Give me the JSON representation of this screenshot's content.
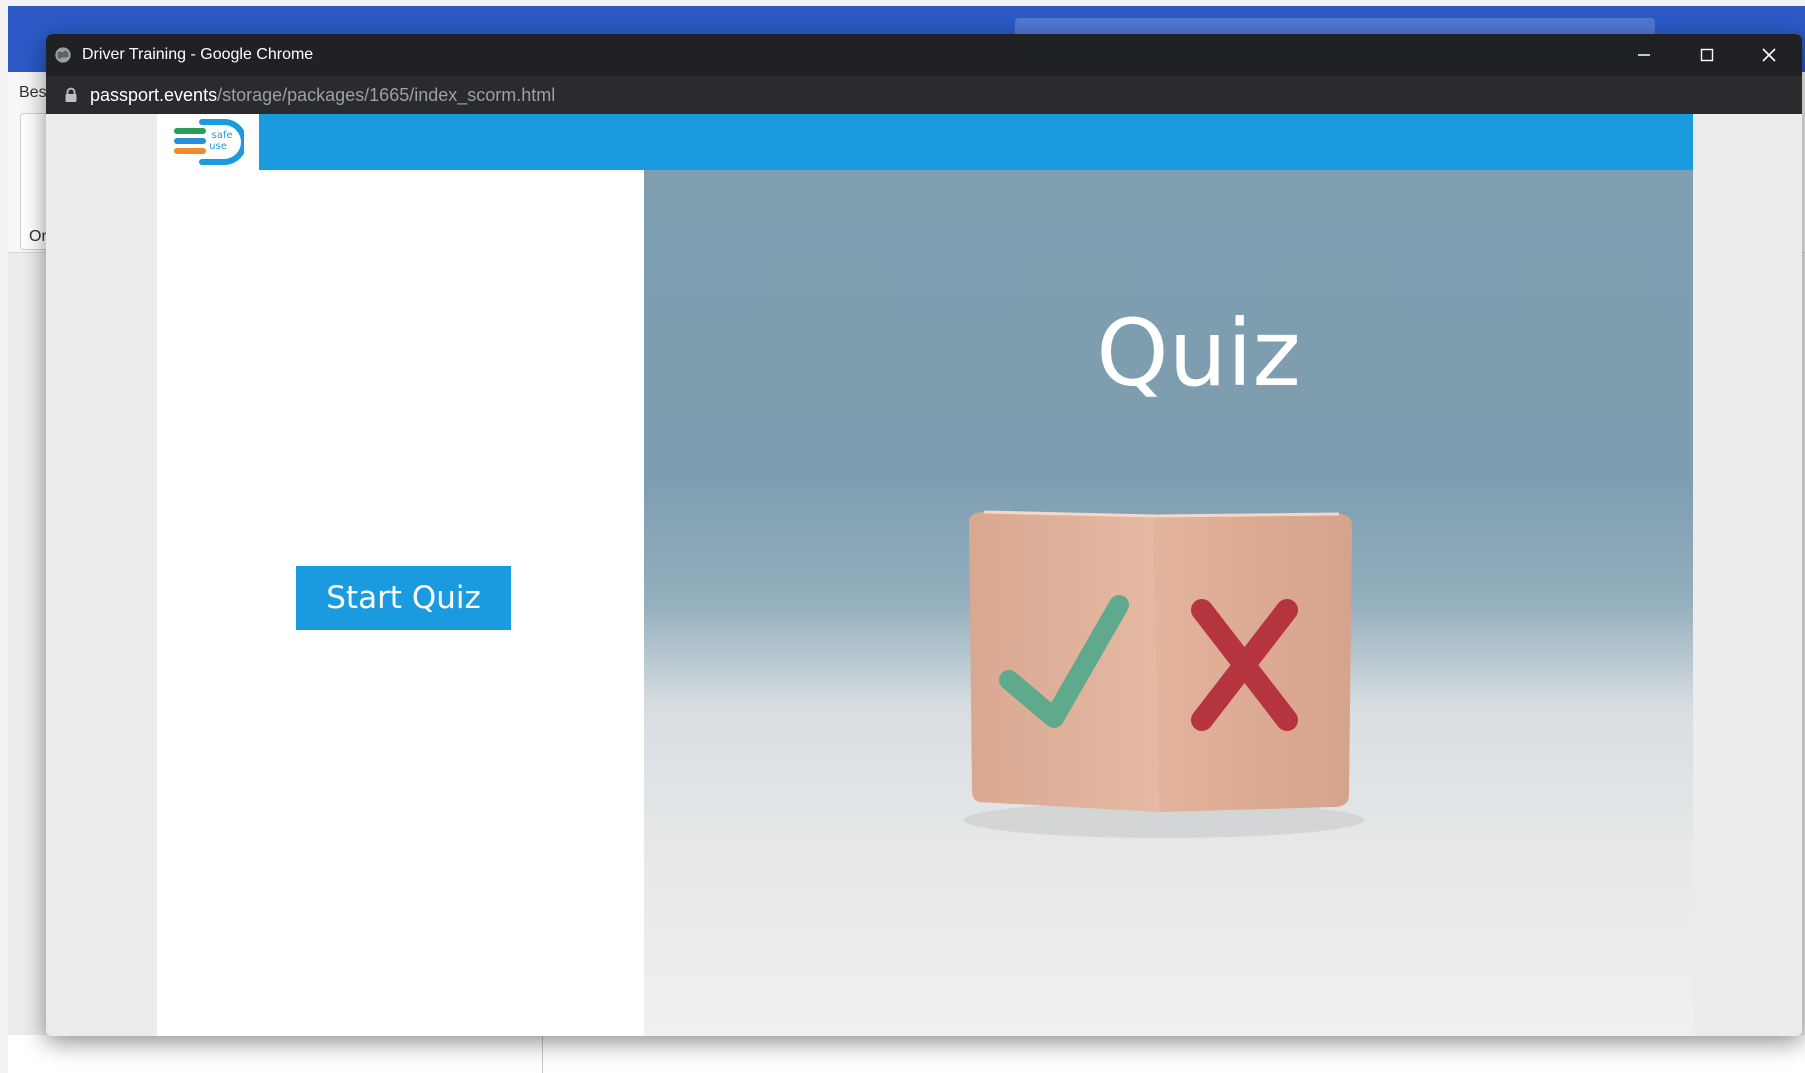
{
  "background_window": {
    "left_text_1": "Bes",
    "left_text_2": "Or"
  },
  "popup": {
    "title": "Driver Training - Google Chrome",
    "url": {
      "host": "passport.events",
      "path": "/storage/packages/1665/index_scorm.html"
    },
    "controls": [
      "minimize",
      "maximize",
      "close"
    ]
  },
  "course": {
    "logo_text": [
      "safe",
      "use"
    ],
    "start_button_label": "Start Quiz",
    "hero_title": "Quiz",
    "colors": {
      "brand_blue": "#1a9be0",
      "check_green": "#5fa98c",
      "cross_red": "#b5343f"
    }
  }
}
